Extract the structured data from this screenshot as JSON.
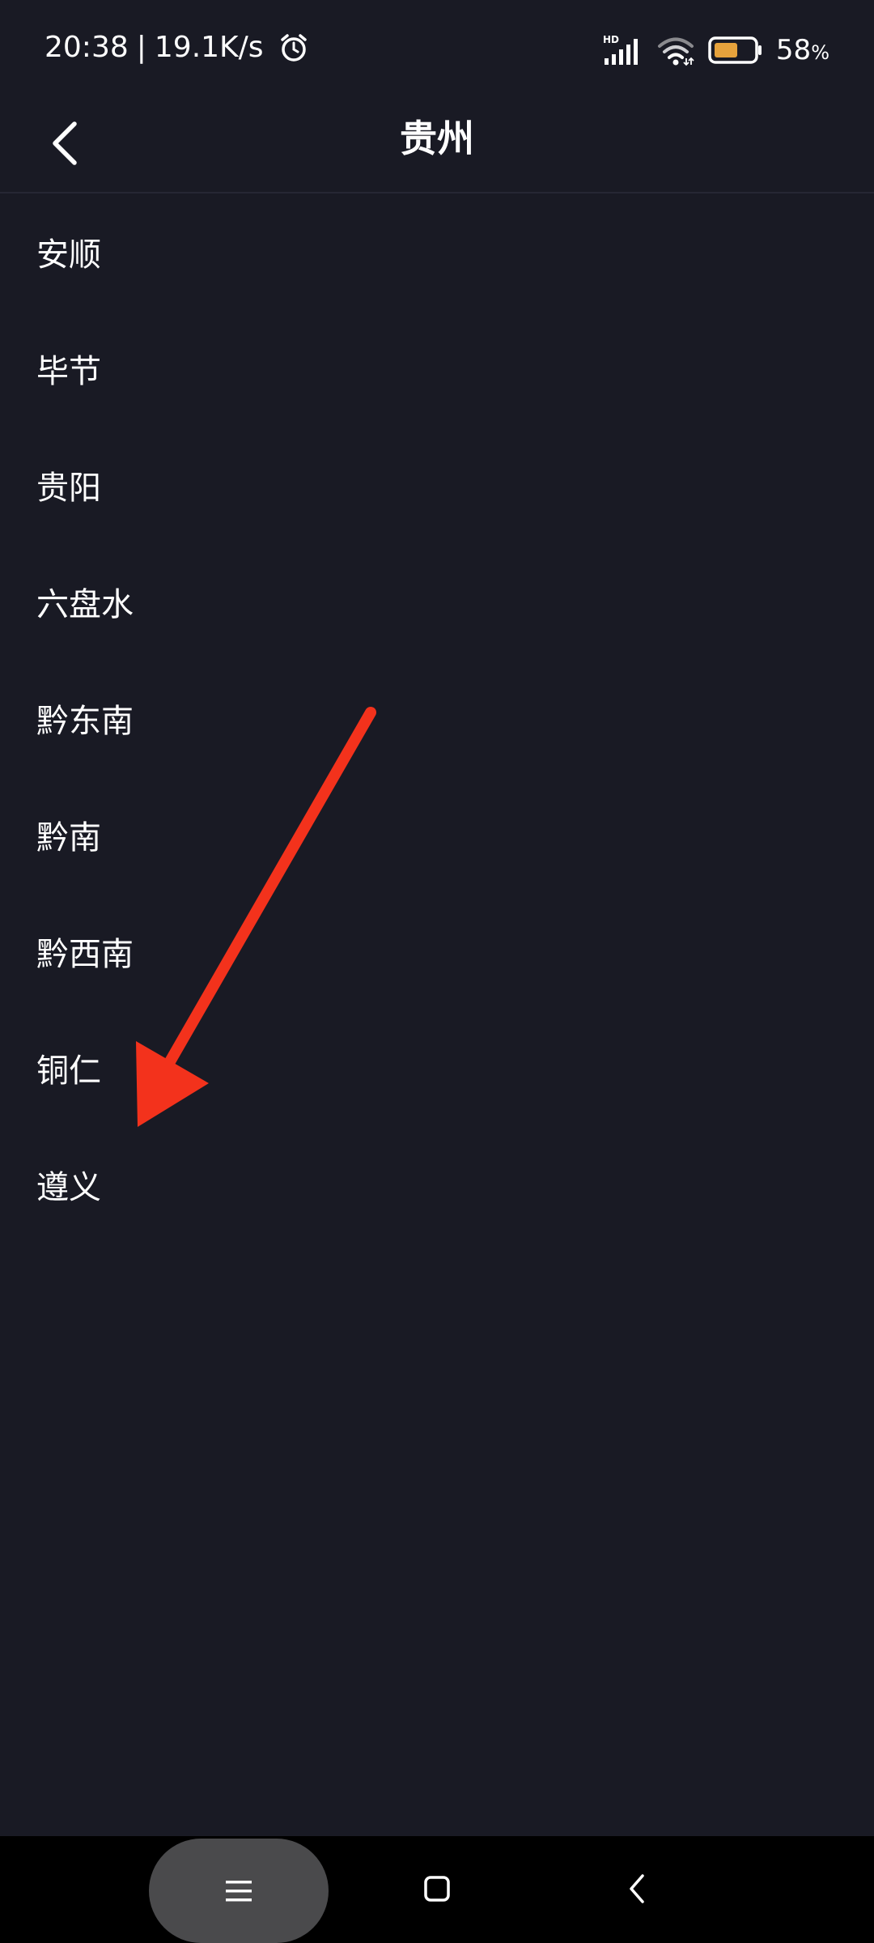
{
  "status_bar": {
    "time": "20:38",
    "separator": "|",
    "speed": "19.1K/s",
    "signal_label": "HD",
    "battery_value": "58",
    "battery_unit": "%",
    "battery_fill_color": "#e6a23c"
  },
  "header": {
    "title": "贵州",
    "back_icon": "chevron-left-icon"
  },
  "cities": [
    {
      "label": "安顺"
    },
    {
      "label": "毕节"
    },
    {
      "label": "贵阳"
    },
    {
      "label": "六盘水"
    },
    {
      "label": "黔东南"
    },
    {
      "label": "黔南"
    },
    {
      "label": "黔西南"
    },
    {
      "label": "铜仁"
    },
    {
      "label": "遵义"
    }
  ],
  "annotation": {
    "color": "#f3321c"
  },
  "nav_bar": {
    "menu_icon": "menu-icon",
    "home_icon": "home-square-icon",
    "back_icon": "back-chevron-icon"
  }
}
